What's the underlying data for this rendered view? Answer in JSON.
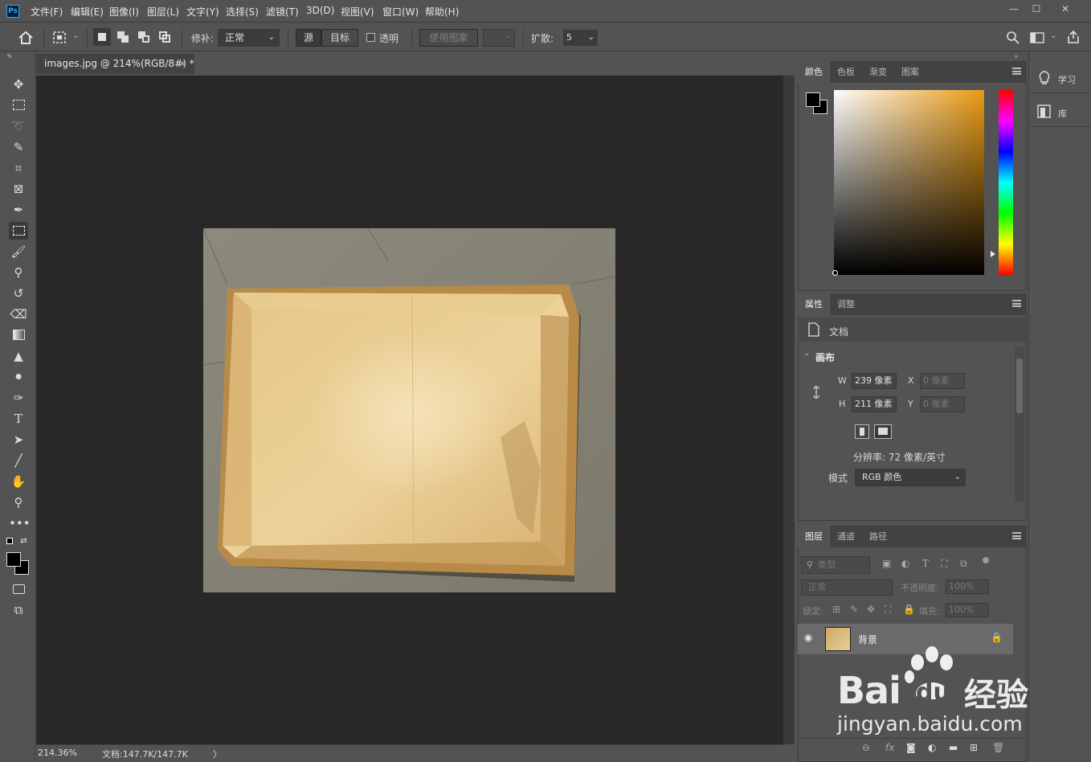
{
  "app": {
    "logo": "Ps"
  },
  "menu": [
    "文件(F)",
    "编辑(E)",
    "图像(I)",
    "图层(L)",
    "文字(Y)",
    "选择(S)",
    "滤镜(T)",
    "3D(D)",
    "视图(V)",
    "窗口(W)",
    "帮助(H)"
  ],
  "window_controls": {
    "min": "—",
    "max": "☐",
    "close": "✕"
  },
  "options": {
    "patch_label": "修补:",
    "patch_mode": "正常",
    "source_label": "源",
    "dest_label": "目标",
    "transparent_label": "透明",
    "use_pattern_label": "使用图案",
    "diffusion_label": "扩散:",
    "diffusion_value": "5"
  },
  "document": {
    "tab_title": "images.jpg @ 214%(RGB/8#) *",
    "close": "×",
    "zoom": "214.36%",
    "doc_info": "文档:147.7K/147.7K",
    "arrow": "〉"
  },
  "color_panel": {
    "tabs": [
      "颜色",
      "色板",
      "渐变",
      "图案"
    ],
    "accent": "#e89a12"
  },
  "properties_panel": {
    "tabs": [
      "属性",
      "调整"
    ],
    "doc_label": "文档",
    "section": "画布",
    "w_label": "W",
    "w_value": "239 像素",
    "h_label": "H",
    "h_value": "211 像素",
    "x_label": "X",
    "x_value": "0 像素",
    "y_label": "Y",
    "y_value": "0 像素",
    "resolution": "分辨率: 72 像素/英寸",
    "mode_label": "模式",
    "mode_value": "RGB 颜色"
  },
  "layers_panel": {
    "tabs": [
      "图层",
      "通道",
      "路径"
    ],
    "filter_placeholder": "类型",
    "blend_mode": "正常",
    "opacity_label": "不透明度:",
    "opacity_value": "100%",
    "lock_label": "锁定:",
    "fill_label": "填充:",
    "fill_value": "100%",
    "layer_name": "背景"
  },
  "learn_panel": {
    "learn": "学习",
    "library": "库"
  },
  "watermark": {
    "brand": "Bai",
    "paw": "du",
    "cn": "经验",
    "url": "jingyan.baidu.com"
  }
}
